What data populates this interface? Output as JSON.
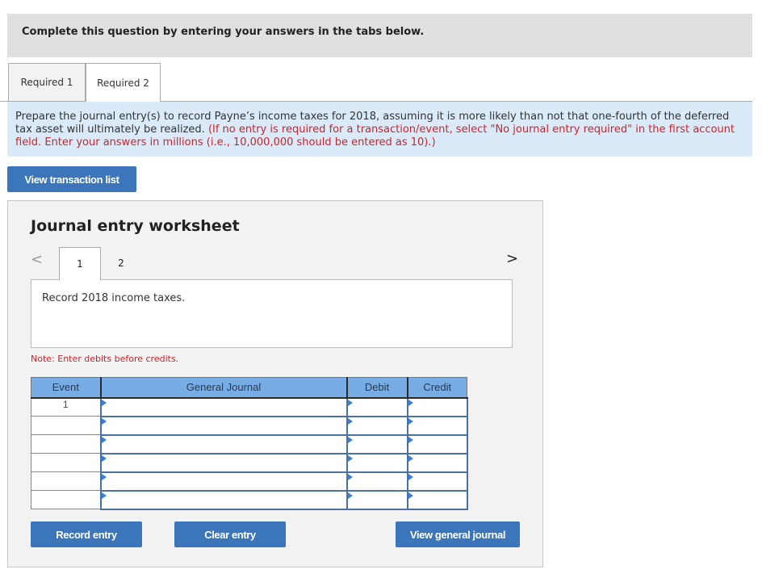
{
  "instructions": "Complete this question by entering your answers in the tabs below.",
  "tabs": [
    {
      "label": "Required 1",
      "active": false
    },
    {
      "label": "Required 2",
      "active": true
    }
  ],
  "prompt": {
    "text": "Prepare the journal entry(s) to record Payne’s income taxes for 2018, assuming it is more likely than not that one-fourth of the deferred tax asset will ultimately be realized.",
    "hint": "(If no entry is required for a transaction/event, select \"No journal entry required\" in the first account field. Enter your answers in millions (i.e., 10,000,000 should be entered as 10).)"
  },
  "buttons": {
    "view_transaction_list": "View transaction list",
    "record_entry": "Record entry",
    "clear_entry": "Clear entry",
    "view_general_journal": "View general journal"
  },
  "worksheet": {
    "title": "Journal entry worksheet",
    "nav_prev": "<",
    "nav_next": ">",
    "entry_tabs": [
      "1",
      "2"
    ],
    "active_entry": "1",
    "description": "Record 2018 income taxes.",
    "note": "Note: Enter debits before credits."
  },
  "journal": {
    "headers": {
      "event": "Event",
      "general_journal": "General Journal",
      "debit": "Debit",
      "credit": "Credit"
    },
    "rows": [
      {
        "event": "1",
        "account": "",
        "debit": "",
        "credit": ""
      },
      {
        "event": "",
        "account": "",
        "debit": "",
        "credit": ""
      },
      {
        "event": "",
        "account": "",
        "debit": "",
        "credit": ""
      },
      {
        "event": "",
        "account": "",
        "debit": "",
        "credit": ""
      },
      {
        "event": "",
        "account": "",
        "debit": "",
        "credit": ""
      },
      {
        "event": "",
        "account": "",
        "debit": "",
        "credit": ""
      }
    ]
  }
}
